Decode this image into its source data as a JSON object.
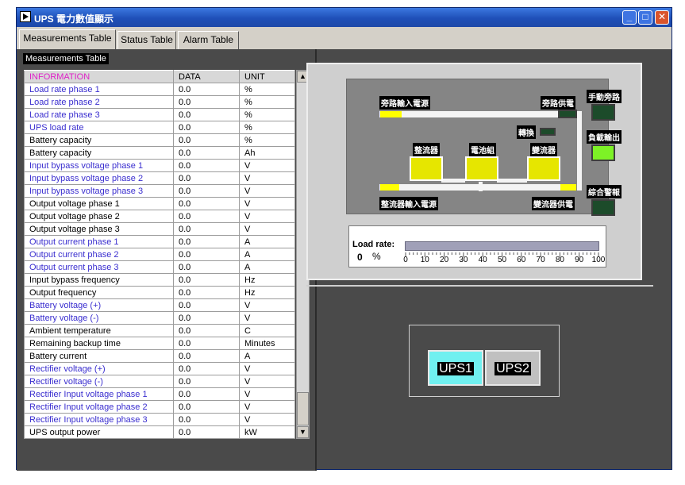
{
  "window": {
    "title": "UPS 電力數值顯示",
    "min_glyph": "_",
    "max_glyph": "□",
    "close_glyph": "✕"
  },
  "tabs": [
    {
      "label": "Measurements Table",
      "active": true
    },
    {
      "label": "Status Table",
      "active": false
    },
    {
      "label": "Alarm Table",
      "active": false
    }
  ],
  "table": {
    "section_title": "Measurements Table",
    "headers": [
      "INFORMATION",
      "DATA",
      "UNIT"
    ],
    "rows": [
      {
        "info": "Load rate phase 1",
        "data": "0.0",
        "unit": "%",
        "blue": true
      },
      {
        "info": "Load rate phase 2",
        "data": "0.0",
        "unit": "%",
        "blue": true
      },
      {
        "info": "Load rate phase 3",
        "data": "0.0",
        "unit": "%",
        "blue": true
      },
      {
        "info": "UPS load rate",
        "data": "0.0",
        "unit": "%",
        "blue": true
      },
      {
        "info": "Battery capacity",
        "data": "0.0",
        "unit": "%",
        "blue": false
      },
      {
        "info": "Battery capacity",
        "data": "0.0",
        "unit": "Ah",
        "blue": false
      },
      {
        "info": "Input bypass voltage phase 1",
        "data": "0.0",
        "unit": "V",
        "blue": true
      },
      {
        "info": "Input bypass voltage phase 2",
        "data": "0.0",
        "unit": "V",
        "blue": true
      },
      {
        "info": "Input bypass voltage phase 3",
        "data": "0.0",
        "unit": "V",
        "blue": true
      },
      {
        "info": "Output voltage phase 1",
        "data": "0.0",
        "unit": "V",
        "blue": false
      },
      {
        "info": "Output voltage phase 2",
        "data": "0.0",
        "unit": "V",
        "blue": false
      },
      {
        "info": "Output voltage phase 3",
        "data": "0.0",
        "unit": "V",
        "blue": false
      },
      {
        "info": "Output current phase 1",
        "data": "0.0",
        "unit": "A",
        "blue": true
      },
      {
        "info": "Output current phase 2",
        "data": "0.0",
        "unit": "A",
        "blue": true
      },
      {
        "info": "Output current phase 3",
        "data": "0.0",
        "unit": "A",
        "blue": true
      },
      {
        "info": "Input bypass frequency",
        "data": "0.0",
        "unit": "Hz",
        "blue": false
      },
      {
        "info": "Output frequency",
        "data": "0.0",
        "unit": "Hz",
        "blue": false
      },
      {
        "info": "Battery voltage (+)",
        "data": "0.0",
        "unit": "V",
        "blue": true
      },
      {
        "info": "Battery voltage (-)",
        "data": "0.0",
        "unit": "V",
        "blue": true
      },
      {
        "info": "Ambient temperature",
        "data": "0.0",
        "unit": "C",
        "blue": false
      },
      {
        "info": "Remaining backup time",
        "data": "0.0",
        "unit": "Minutes",
        "blue": false
      },
      {
        "info": "Battery current",
        "data": "0.0",
        "unit": "A",
        "blue": false
      },
      {
        "info": "Rectifier voltage (+)",
        "data": "0.0",
        "unit": "V",
        "blue": true
      },
      {
        "info": "Rectifier voltage (-)",
        "data": "0.0",
        "unit": "V",
        "blue": true
      },
      {
        "info": "Rectifier Input voltage phase 1",
        "data": "0.0",
        "unit": "V",
        "blue": true
      },
      {
        "info": "Rectifier Input voltage phase 2",
        "data": "0.0",
        "unit": "V",
        "blue": true
      },
      {
        "info": "Rectifier Input voltage phase 3",
        "data": "0.0",
        "unit": "V",
        "blue": true
      },
      {
        "info": "UPS output power",
        "data": "0.0",
        "unit": "kW",
        "blue": false
      }
    ],
    "scroll_up_glyph": "▲",
    "scroll_down_glyph": "▼"
  },
  "diagram": {
    "bypass_input": "旁路輸入電源",
    "bypass_supply": "旁路供電",
    "manual_bypass": "手動旁路",
    "transfer": "轉換",
    "load_output": "負載輸出",
    "rectifier": "整流器",
    "battery": "電池組",
    "inverter": "變流器",
    "rectifier_input": "整流器輸入電源",
    "inverter_supply": "變流器供電",
    "general_alarm": "綜合警報",
    "indicators": {
      "manual_bypass_on": false,
      "transfer_on": false,
      "bypass_supply_on": false,
      "load_output_on": true,
      "general_alarm_on": false
    }
  },
  "load_rate": {
    "label": "Load rate:",
    "value": "0",
    "value_fraction": 0,
    "unit": "%",
    "ticks": [
      "0",
      "10",
      "20",
      "30",
      "40",
      "50",
      "60",
      "70",
      "80",
      "90",
      "100"
    ]
  },
  "ups_select": {
    "ups1": "UPS1",
    "ups2": "UPS2",
    "selected": "UPS1"
  },
  "colors": {
    "info_blue": "#3a2ecf",
    "header_magenta": "#e020c8",
    "indicator_on": "#7df226",
    "indicator_off": "#1c4b2a",
    "ups_selected": "#70f0f0"
  }
}
